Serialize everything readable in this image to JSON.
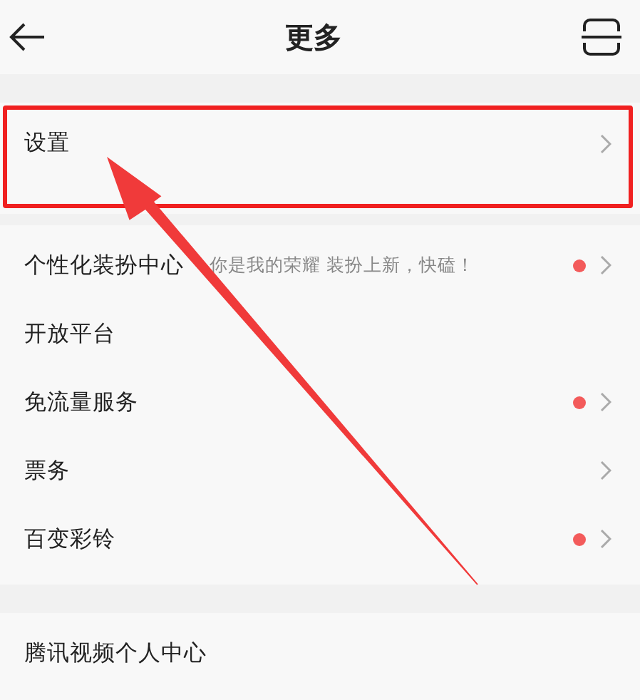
{
  "header": {
    "title": "更多"
  },
  "groups": [
    {
      "items": [
        {
          "title": "设置",
          "dot": false,
          "chevron": true,
          "highlighted": true
        }
      ]
    },
    {
      "items": [
        {
          "title": "个性化装扮中心",
          "subtitle": "你是我的荣耀 装扮上新，快磕！",
          "dot": true,
          "chevron": true,
          "highlighted": false
        },
        {
          "title": "开放平台",
          "dot": false,
          "chevron": false,
          "highlighted": false
        },
        {
          "title": "免流量服务",
          "dot": true,
          "chevron": true,
          "highlighted": false
        },
        {
          "title": "票务",
          "dot": false,
          "chevron": true,
          "highlighted": false
        },
        {
          "title": "百变彩铃",
          "dot": true,
          "chevron": true,
          "highlighted": false
        }
      ]
    },
    {
      "items": [
        {
          "title": "腾讯视频个人中心",
          "dot": false,
          "chevron": false,
          "highlighted": false
        }
      ]
    }
  ],
  "annotation": {
    "arrow": true
  }
}
